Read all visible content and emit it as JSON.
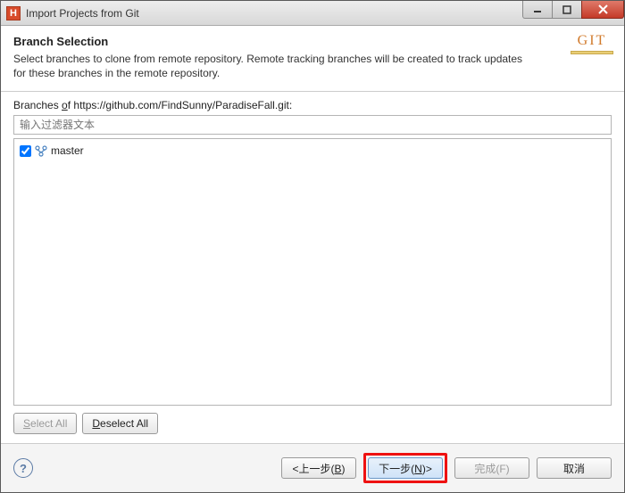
{
  "window": {
    "title": "Import Projects from Git"
  },
  "header": {
    "heading": "Branch Selection",
    "description": "Select branches to clone from remote repository. Remote tracking branches will be created to track updates for these branches in the remote repository."
  },
  "branches": {
    "label_prefix": "Branches ",
    "label_of": "o",
    "label_f": "f ",
    "repo_url": "https://github.com/FindSunny/ParadiseFall.git:",
    "filter_placeholder": "输入过滤器文本",
    "items": [
      {
        "name": "master",
        "checked": true
      }
    ]
  },
  "select_buttons": {
    "select_all_s": "S",
    "select_all_rest": "elect All",
    "deselect_all_d": "D",
    "deselect_all_rest": "eselect All"
  },
  "footer": {
    "help": "?",
    "back": "<上一步(",
    "back_u": "B",
    "back_end": ")",
    "next": "下一步(",
    "next_u": "N",
    "next_end": ")>",
    "finish": "完成(",
    "finish_u": "F",
    "finish_end": ")",
    "cancel": "取消"
  },
  "git_logo": {
    "text": "GIT"
  }
}
